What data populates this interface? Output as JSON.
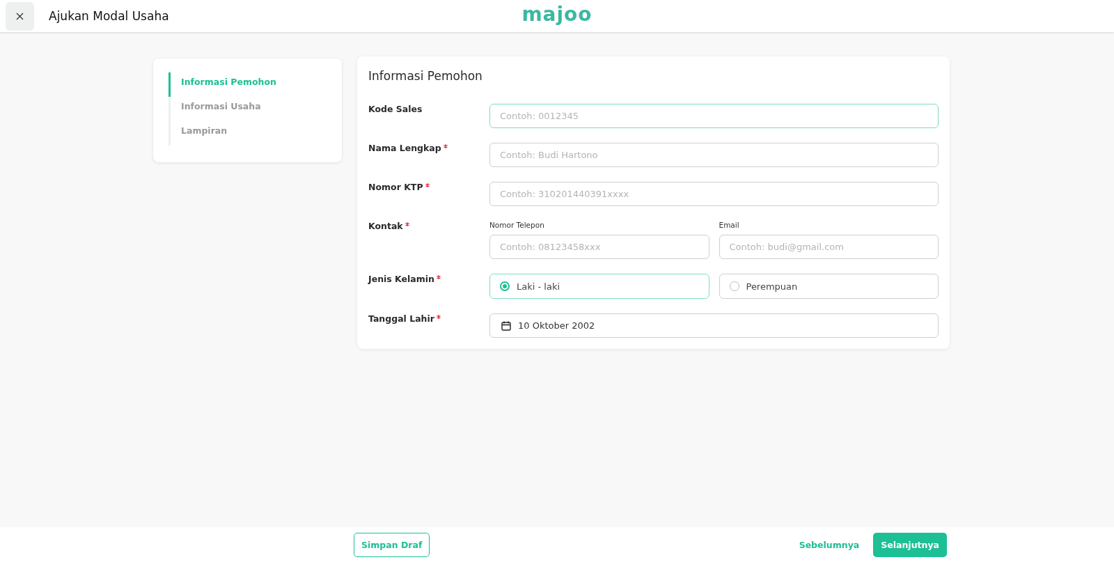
{
  "header": {
    "title": "Ajukan Modal Usaha",
    "logo": "majoo"
  },
  "steps": [
    {
      "label": "Informasi Pemohon",
      "selected": true
    },
    {
      "label": "Informasi Usaha",
      "selected": false
    },
    {
      "label": "Lampiran",
      "selected": false
    }
  ],
  "form": {
    "title": "Informasi Pemohon",
    "fields": [
      {
        "kind": "text",
        "label": "Kode Sales",
        "required": false,
        "placeholder": "Contoh: 0012345",
        "focused": true
      },
      {
        "kind": "text",
        "label": "Nama Lengkap",
        "required": true,
        "placeholder": "Contoh: Budi Hartono",
        "focused": false
      },
      {
        "kind": "text",
        "label": "Nomor KTP",
        "required": true,
        "placeholder": "Contoh: 310201440391xxxx",
        "focused": false
      },
      {
        "kind": "contact",
        "label": "Kontak",
        "required": true,
        "inputs": [
          {
            "label": "Nomor Telepon",
            "placeholder": "Contoh: 08123458xxx"
          },
          {
            "label": "Email",
            "placeholder": "Contoh: budi@gmail.com"
          }
        ]
      },
      {
        "kind": "radio",
        "label": "Jenis Kelamin",
        "required": true,
        "options": [
          {
            "label": "Laki - laki",
            "selected": true
          },
          {
            "label": "Perempuan",
            "selected": false
          }
        ]
      },
      {
        "kind": "date",
        "label": "Tanggal Lahir",
        "required": true,
        "value": "10 Oktober 2002"
      }
    ]
  },
  "footer": {
    "draft": "Simpan Draf",
    "previous": "Sebelumnya",
    "next": "Selanjutnya"
  }
}
